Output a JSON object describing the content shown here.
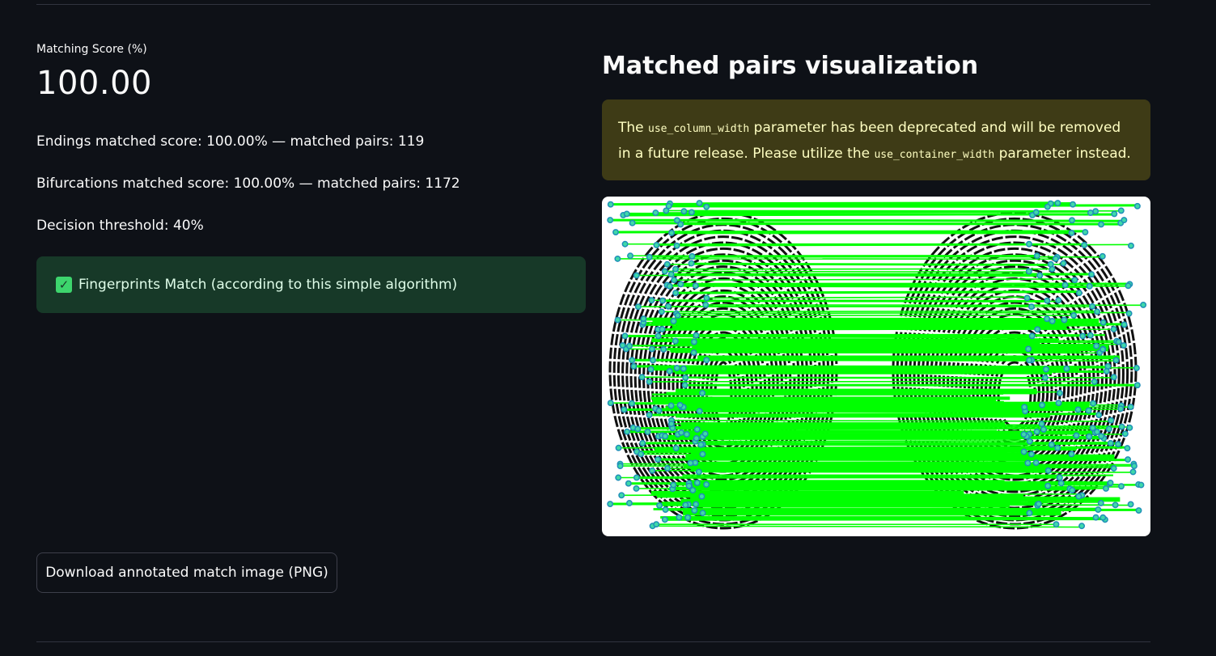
{
  "metric": {
    "label": "Matching Score (%)",
    "value": "100.00"
  },
  "stats": {
    "endings": "Endings matched score: 100.00% — matched pairs: 119",
    "bifurcations": "Bifurcations matched score: 100.00% — matched pairs: 1172",
    "threshold": "Decision threshold: 40%"
  },
  "result": {
    "icon": "check-mark-icon",
    "text": "Fingerprints Match (according to this simple algorithm)"
  },
  "download_button": {
    "label": "Download annotated match image (PNG)"
  },
  "visualization": {
    "heading": "Matched pairs visualization",
    "warning": {
      "part1": "The ",
      "code1": "use_column_width",
      "part2": " parameter has been deprecated and will be removed in a future release. Please utilize the ",
      "code2": "use_container_width",
      "part3": " parameter instead."
    }
  },
  "colors": {
    "background": "#0e1117",
    "success_bg": "#173928",
    "warning_bg": "#3e3b16",
    "match_line": "#00ff00",
    "minutia_dot": "#1f8fb8"
  }
}
